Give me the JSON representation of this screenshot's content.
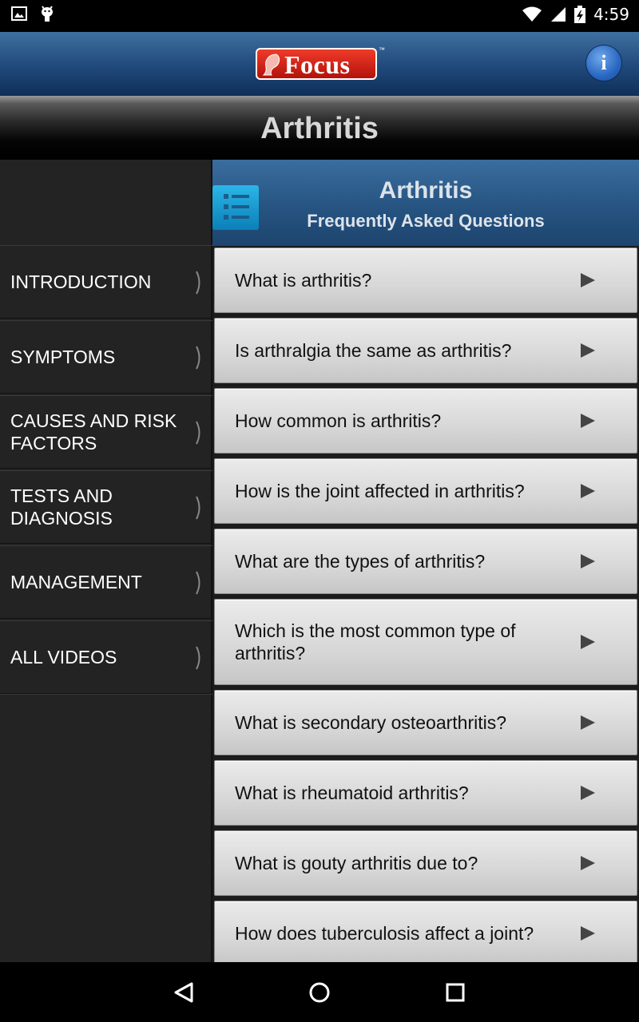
{
  "status_bar": {
    "time": "4:59",
    "icons": [
      "image-icon",
      "android-icon",
      "wifi-icon",
      "cell-signal-icon",
      "battery-charging-icon"
    ]
  },
  "header": {
    "logo_text": "Focus",
    "logo_tm": "™",
    "info_label": "i"
  },
  "page": {
    "title": "Arthritis"
  },
  "sidebar": {
    "items": [
      {
        "label": "INTRODUCTION"
      },
      {
        "label": "SYMPTOMS"
      },
      {
        "label": "CAUSES AND RISK FACTORS"
      },
      {
        "label": "TESTS AND DIAGNOSIS"
      },
      {
        "label": "MANAGEMENT"
      },
      {
        "label": "ALL VIDEOS"
      }
    ]
  },
  "faq": {
    "title": "Arthritis",
    "subtitle": "Frequently Asked Questions",
    "questions": [
      {
        "text": "What is arthritis?"
      },
      {
        "text": "Is arthralgia the same as arthritis?"
      },
      {
        "text": "How common is arthritis?"
      },
      {
        "text": "How is the joint affected in arthritis?"
      },
      {
        "text": "What are the types of arthritis?"
      },
      {
        "text": "Which is the most common type of arthritis?"
      },
      {
        "text": "What is secondary osteoarthritis?"
      },
      {
        "text": "What is rheumatoid arthritis?"
      },
      {
        "text": "What is gouty arthritis due to?"
      },
      {
        "text": "How does tuberculosis affect a joint?"
      }
    ]
  },
  "colors": {
    "header_blue": "#20497a",
    "logo_red": "#d42416",
    "sidebar_bg": "#232323",
    "faq_item_bg": "#d7d7d7"
  },
  "nav": {
    "icons": [
      "back-icon",
      "home-icon",
      "recents-icon"
    ]
  }
}
